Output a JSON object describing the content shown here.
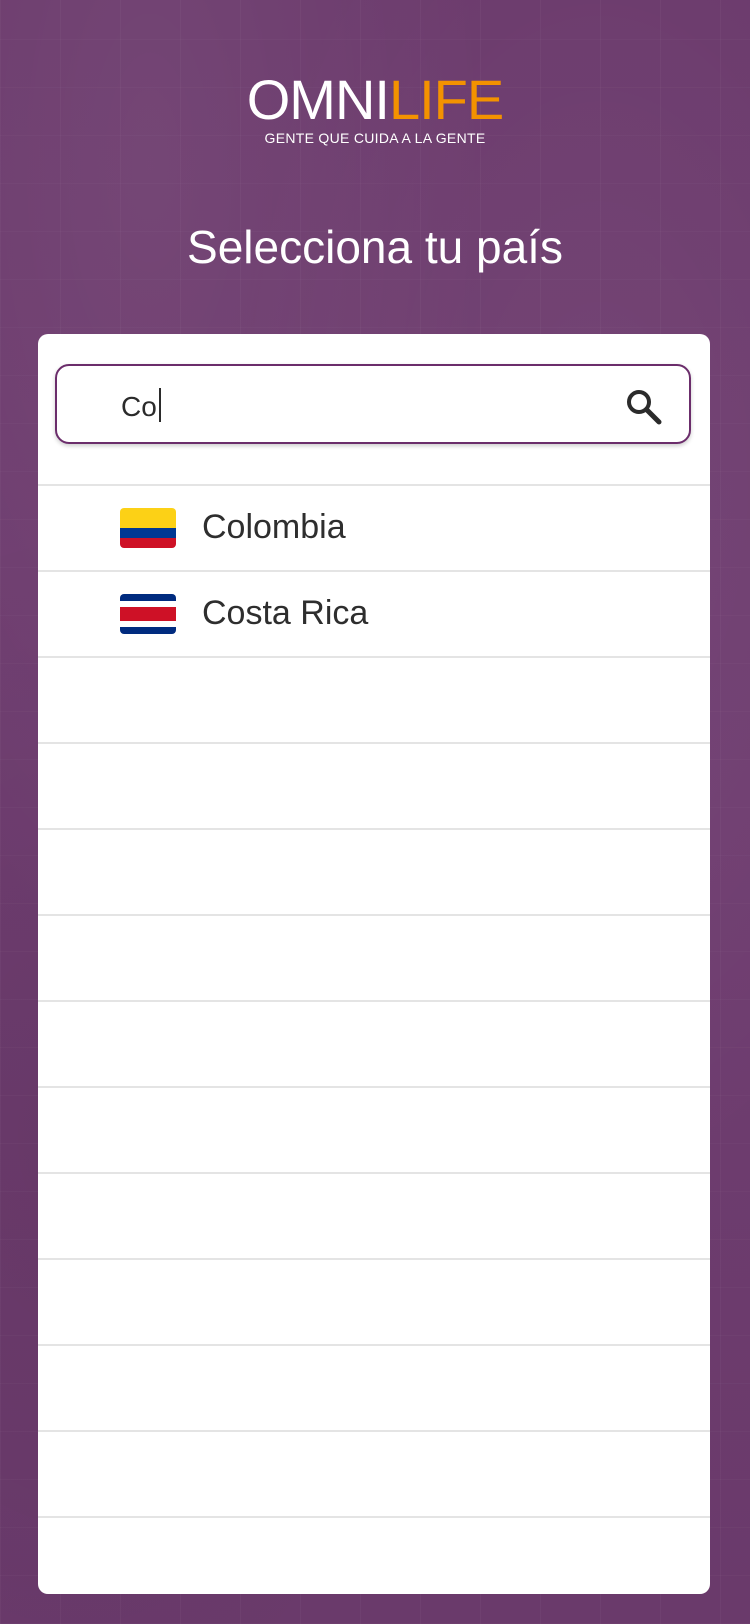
{
  "app": {
    "logo": {
      "omni": "OMNI",
      "life": "LIFE",
      "tagline": "GENTE QUE CUIDA A LA GENTE"
    },
    "title": "Selecciona tu país"
  },
  "search": {
    "value": "Co",
    "icon": "search-icon"
  },
  "countries": [
    {
      "name": "Colombia",
      "flag": "colombia-flag"
    },
    {
      "name": "Costa Rica",
      "flag": "costa-rica-flag"
    }
  ],
  "colors": {
    "background": "#6e3b6f",
    "brand_orange": "#f39200",
    "search_border": "#6b2d6b"
  }
}
